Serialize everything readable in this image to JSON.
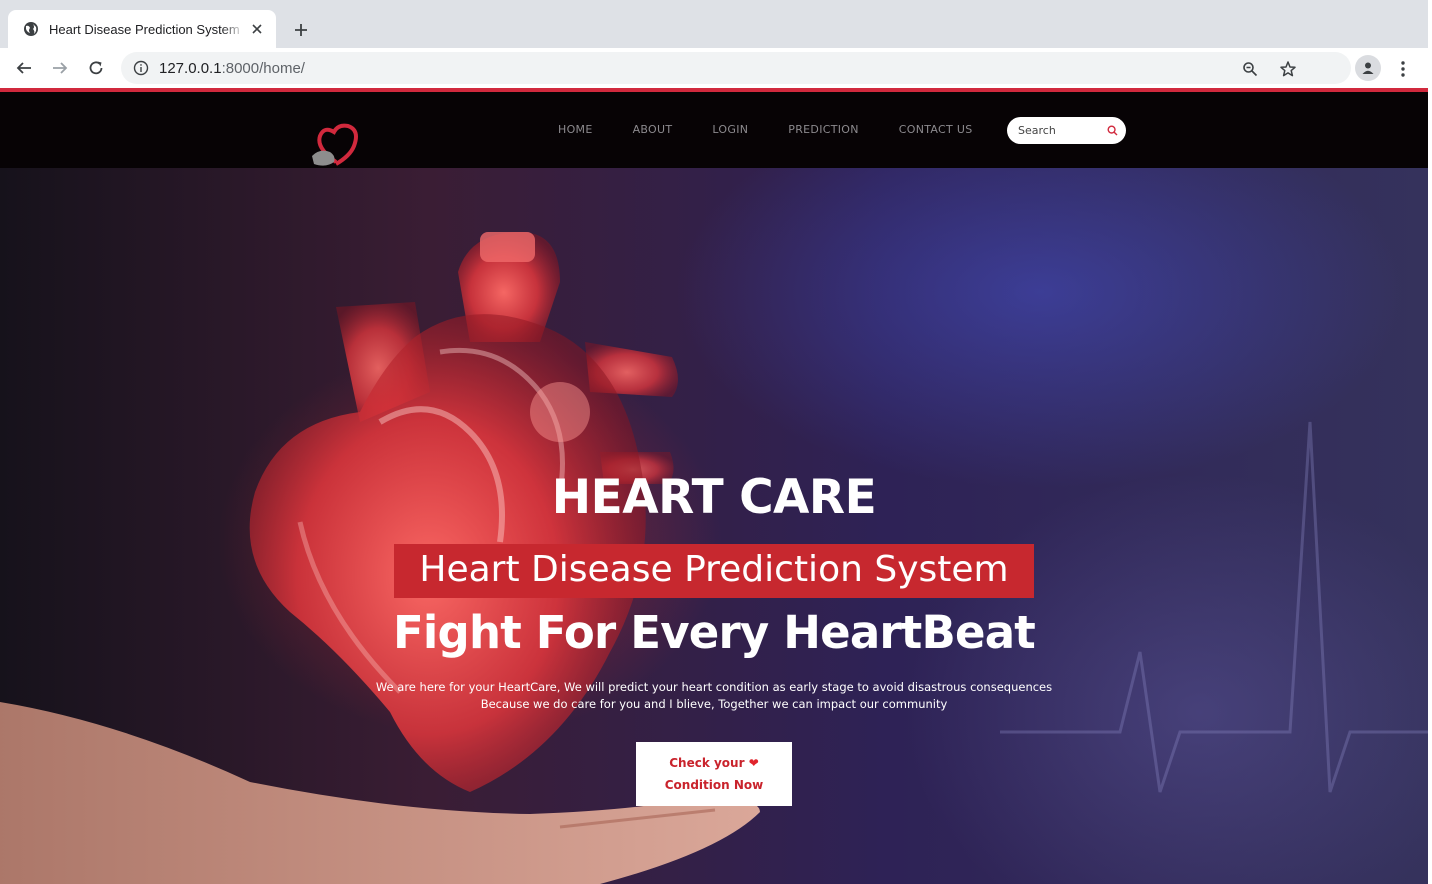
{
  "browser": {
    "tab_title": "Heart Disease Prediction System",
    "url_host": "127.0.0.1",
    "url_rest": ":8000/home/"
  },
  "site": {
    "nav": [
      "HOME",
      "ABOUT",
      "LOGIN",
      "PREDICTION",
      "CONTACT US"
    ],
    "search_placeholder": "Search"
  },
  "hero": {
    "title": "HEART CARE",
    "subtitle": "Heart Disease Prediction System",
    "tagline": "Fight For Every HeartBeat",
    "desc_line1": "We are here for your HeartCare, We will predict your heart condition as early stage to avoid disastrous consequences",
    "desc_line2": "Because we do care for you and I blieve, Together we can impact our community",
    "cta_line1": "Check your",
    "cta_line2": "Condition Now",
    "cta_heart": "❤"
  },
  "colors": {
    "accent": "#d1293d",
    "band": "#c7282f",
    "nav_bg": "#070305"
  },
  "icons": [
    "globe-icon",
    "close-icon",
    "plus-icon",
    "back-icon",
    "forward-icon",
    "reload-icon",
    "info-icon",
    "zoom-icon",
    "star-icon",
    "avatar-icon",
    "menu-icon",
    "heart-logo-icon",
    "search-icon"
  ]
}
